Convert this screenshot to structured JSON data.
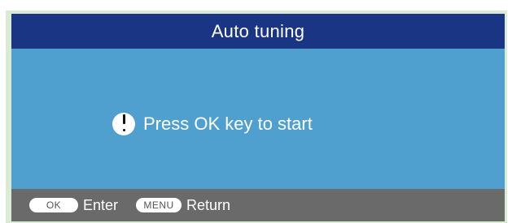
{
  "title": "Auto tuning",
  "message": {
    "icon": "exclamation-icon",
    "text": "Press OK key to start"
  },
  "footer": {
    "hints": [
      {
        "key": "OK",
        "label": "Enter"
      },
      {
        "key": "MENU",
        "label": "Return"
      }
    ]
  },
  "colors": {
    "title_bar": "#1b3585",
    "panel": "#4f9fcf",
    "footer": "#6a6a6a",
    "border": "#d9ecd3"
  }
}
